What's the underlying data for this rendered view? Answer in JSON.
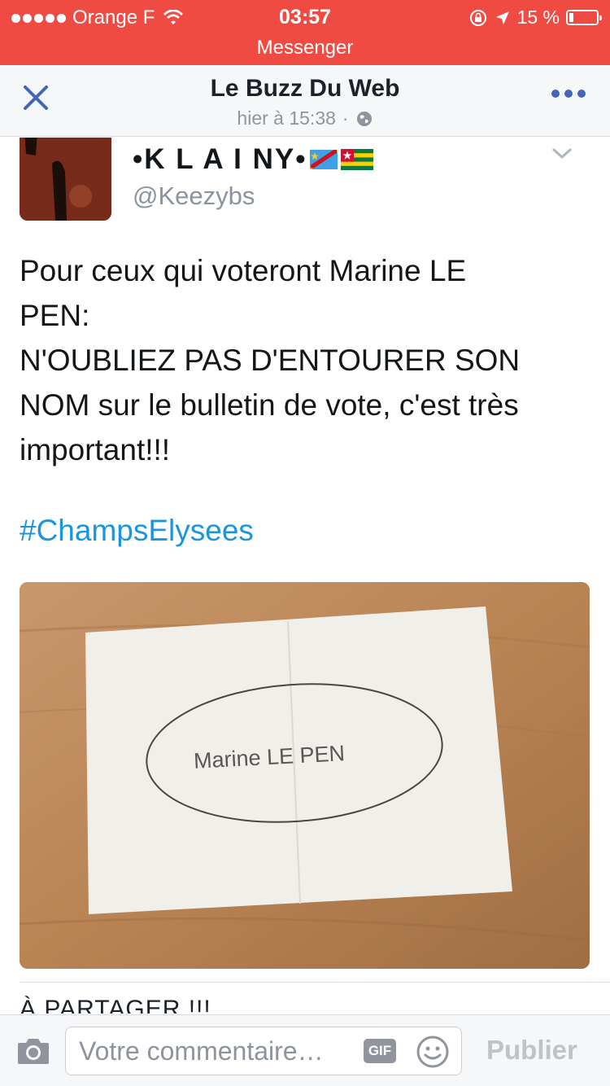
{
  "status_bar": {
    "carrier": "Orange F",
    "time": "03:57",
    "battery_percent": "15 %",
    "battery_level": 0.15
  },
  "back_app": "Messenger",
  "nav": {
    "title": "Le Buzz Du Web",
    "subtitle": "hier à 15:38",
    "separator": "·"
  },
  "tweet": {
    "author": "•K L A I NY•",
    "handle": "@Keezybs",
    "text": "Pour ceux qui voteront Marine LE\nPEN:\nN'OUBLIEZ PAS D'ENTOURER SON\nNOM sur le bulletin de vote, c'est très\nimportant!!!",
    "hashtag": "#ChampsElysees",
    "photo": {
      "ballot_first_name": "Marine",
      "ballot_last_name": "LE PEN"
    }
  },
  "post_text_cut": "À PARTAGER !!!",
  "comment_bar": {
    "placeholder": "Votre commentaire…",
    "gif_label": "GIF",
    "publish_label": "Publier"
  },
  "icons": {
    "close": "close-icon",
    "more": "more-icon",
    "globe": "globe-icon",
    "camera": "camera-icon",
    "emoji": "emoji-icon",
    "chevron": "chevron-down-icon"
  },
  "colors": {
    "status_bar": "#f04b43",
    "link_blue": "#1b95e0",
    "fb_blue": "#4267b2"
  }
}
